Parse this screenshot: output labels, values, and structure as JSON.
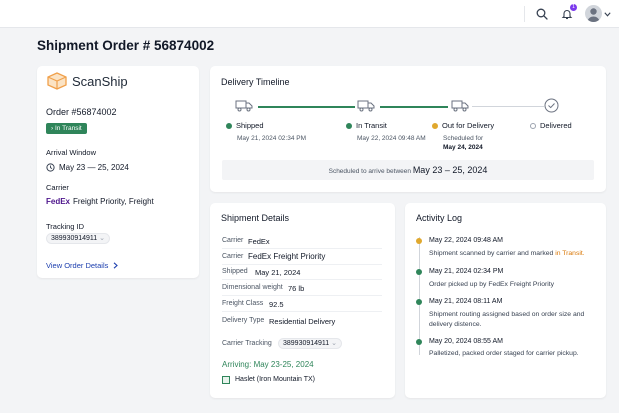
{
  "page": {
    "title": "Shipment Order # 56874002"
  },
  "colors": {
    "accent_green": "#2f855a",
    "pending_amber": "#e0a82e",
    "link_blue": "#1e40af",
    "fedex_purple": "#4d148c",
    "fedex_orange": "#ff6600",
    "brand_orange": "#f0a04b"
  },
  "topbar": {
    "icons": [
      "search-icon",
      "bell-icon",
      "avatar",
      "chevron-down-icon"
    ],
    "notification_count": "1"
  },
  "summary": {
    "brand": "ScanShip",
    "order_number": "Order #56874002",
    "status": "In Transit",
    "arrival_label": "Arrival Window",
    "arrival_value": "May 23  —  25, 2024",
    "carrier_label": "Carrier",
    "carrier_logo": "FedEx",
    "carrier_service": "Freight Priority, Freight",
    "tracking_label": "Tracking ID",
    "tracking_value": "389930914911",
    "view_details": "View Order Details"
  },
  "timeline": {
    "title": "Delivery Timeline",
    "steps": [
      {
        "label": "Shipped",
        "sub": "May 21, 2024 02:34 PM"
      },
      {
        "label": "In Transit",
        "sub": "May 22, 2024 09:48 AM"
      },
      {
        "label": "Out for Delivery",
        "sub": "Scheduled for",
        "sub2": "May 24, 2024"
      },
      {
        "label": "Delivered"
      }
    ],
    "schedule_prefix": "Scheduled to arrive between",
    "schedule_range": "May 23 – 25, 2024"
  },
  "details": {
    "title": "Shipment Details",
    "carrier_label": "Carrier",
    "carrier_value": "FedEx",
    "service_label": "Carrier",
    "service_value": "FedEx Freight Priority",
    "shipped_label": "Shipped",
    "shipped_value": "May 21, 2024",
    "weight_label": "Dimensional weight",
    "weight_value": "76 lb",
    "class_label": "Freight Class",
    "class_value": "92.5",
    "delivery_type_label": "Delivery Type",
    "delivery_type_value": "Residential Delivery",
    "tracking_label": "Carrier Tracking",
    "tracking_value": "389930914911",
    "arriving": "Arriving: May 23-25, 2024",
    "location": "Haslet (Iron Mountain TX)"
  },
  "activity": {
    "title": "Activity Log",
    "entries": [
      {
        "time": "May 22, 2024 09:48 AM",
        "desc_a": "Shipment scanned by carrier and marked",
        "desc_b": "in Transit."
      },
      {
        "time": "May 21, 2024 02:34 PM",
        "desc": "Order picked up by  FedEx Freight Priority"
      },
      {
        "time": "May 21, 2024 08:11 AM",
        "desc": "Shipment routing assigned based on order size and delivery distence."
      },
      {
        "time": "May 20, 2024 08:55 AM",
        "desc": "Palletized, packed order staged for carrier pickup."
      }
    ]
  }
}
